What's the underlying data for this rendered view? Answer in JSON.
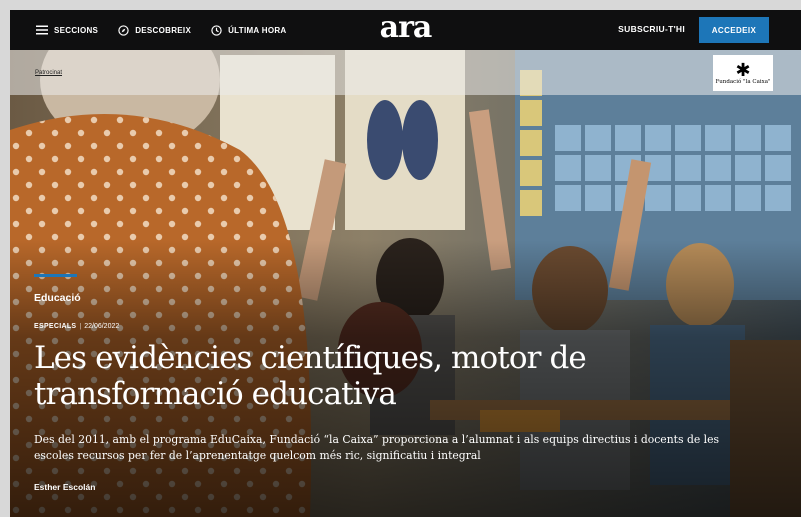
{
  "header": {
    "nav": [
      {
        "label": "SECCIONS",
        "icon": "menu-icon"
      },
      {
        "label": "DESCOBREIX",
        "icon": "compass-icon"
      },
      {
        "label": "ÚLTIMA HORA",
        "icon": "clock-icon"
      }
    ],
    "logo": "ara",
    "subscribe_label": "SUBSCRIU-T'HI",
    "login_label": "ACCEDEIX"
  },
  "sponsor": {
    "label": "Patrocinat",
    "logo_text": "Fundació \"la Caixa\"",
    "logo_icon": "star-icon"
  },
  "article": {
    "category": "Educació",
    "tag": "ESPECIALS",
    "date": "22/06/2022",
    "title": "Les evidències científiques, motor de transformació educativa",
    "lede": "Des del 2011, amb el programa EduCaixa, Fundació “la Caixa” proporciona a l’alumnat i als equips directius i docents de les escoles recursos per fer de l’aprenentatge quelcom més ric, significatiu i integral",
    "author": "Esther Escolán"
  },
  "colors": {
    "header_bg": "#0f0f10",
    "accent": "#1d76b8",
    "text": "#ffffff"
  }
}
